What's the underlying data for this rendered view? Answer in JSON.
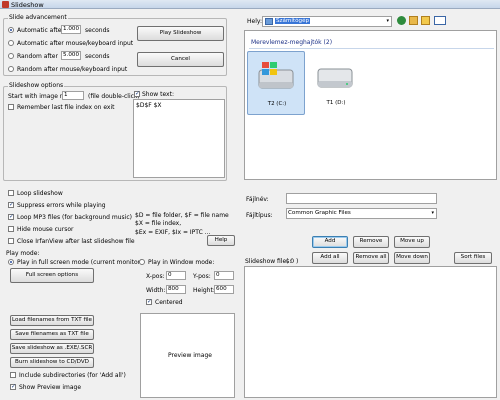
{
  "window": {
    "title": "Slideshow"
  },
  "slideshow_advancement": {
    "title": "Slide advancement",
    "options": [
      {
        "label": "Automatic after",
        "value": "1.000",
        "unit": "seconds"
      },
      {
        "label": "Automatic after mouse/keyboard input"
      },
      {
        "label": "Random   after",
        "value": "5.000",
        "unit": "seconds"
      },
      {
        "label": "Random   after mouse/keyboard input"
      }
    ],
    "play_button": "Play Slideshow",
    "cancel_button": "Cancel"
  },
  "slideshow_options": {
    "title": "Slideshow options",
    "start_with_label": "Start with image nr.:",
    "start_with_value": "1",
    "start_with_hint": "(file double-click)",
    "show_text_label": "Show text:",
    "show_text_value": "$D$F $X",
    "remember_label": "Remember last file index on exit"
  },
  "checkboxes": {
    "loop_slideshow": "Loop slideshow",
    "suppress_errors": "Suppress errors while playing",
    "loop_mp3": "Loop MP3 files (for background music)",
    "hide_cursor": "Hide mouse cursor",
    "close_after": "Close IrfanView after last slideshow file",
    "include_subdirs": "Include subdirectories (for 'Add all')",
    "show_preview": "Show Preview image"
  },
  "help_text": {
    "line1": "$D = file folder, $F = file name",
    "line2": "$X = file index,",
    "line3": "$Ex = EXIF, $Ix = IPTC ...",
    "help_button": "Help"
  },
  "play_mode": {
    "title": "Play mode:",
    "full_screen_label": "Play in full screen mode (current monitor)",
    "full_screen_options_button": "Full screen options",
    "window_mode_label": "Play in Window mode:",
    "xpos_label": "X-pos:",
    "xpos_value": "0",
    "ypos_label": "Y-pos:",
    "ypos_value": "0",
    "width_label": "Width:",
    "width_value": "800",
    "height_label": "Height:",
    "height_value": "600",
    "centered_label": "Centered"
  },
  "file_buttons": {
    "load": "Load filenames from TXT file",
    "save_txt": "Save filenames as TXT file",
    "save_exe": "Save slideshow as .EXE/.SCR",
    "burn": "Burn slideshow to CD/DVD"
  },
  "preview": {
    "label": "Preview image"
  },
  "browser": {
    "location_label": "Hely:",
    "location_value": "Számítógép",
    "group_header": "Merevlemez-meghajtók (2)",
    "drives": [
      {
        "label": "T2 (C:)",
        "icon": "windows-hdd-icon"
      },
      {
        "label": "T1 (D:)",
        "icon": "hdd-icon"
      }
    ],
    "filename_label": "Fájlnév:",
    "filename_value": "",
    "filetype_label": "Fájltípus:",
    "filetype_value": "Common Graphic Files"
  },
  "list_buttons": {
    "add": "Add",
    "remove": "Remove",
    "move_up": "Move up",
    "add_all": "Add all",
    "remove_all": "Remove all",
    "move_down": "Move down",
    "sort_files": "Sort files"
  },
  "slideshow_files": {
    "label": "Slideshow files:",
    "count": "( 0 )"
  }
}
